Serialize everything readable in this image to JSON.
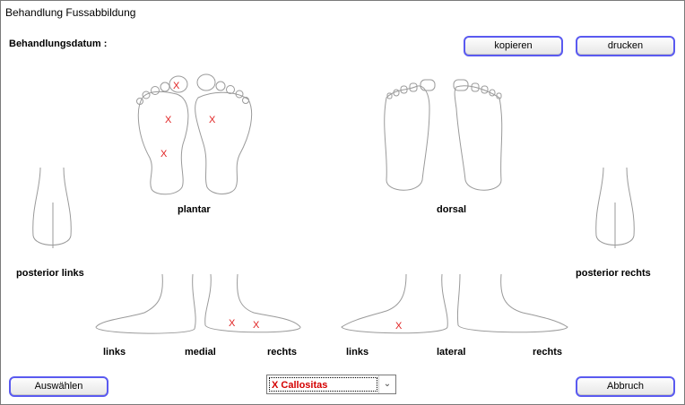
{
  "window": {
    "title": "Behandlung Fussabbildung"
  },
  "header": {
    "date_label": "Behandlungsdatum :"
  },
  "toolbar": {
    "copy_label": "kopieren",
    "print_label": "drucken"
  },
  "views": {
    "plantar": "plantar",
    "dorsal": "dorsal",
    "posterior_left": "posterior links",
    "posterior_right": "posterior rechts",
    "medial_left": "links",
    "medial": "medial",
    "medial_right": "rechts",
    "lateral_left": "links",
    "lateral": "lateral",
    "lateral_right": "rechts"
  },
  "markers": {
    "symbol": "X",
    "color": "#e02020"
  },
  "footer": {
    "select_label": "Auswählen",
    "finding_value": "X Callositas",
    "cancel_label": "Abbruch"
  }
}
